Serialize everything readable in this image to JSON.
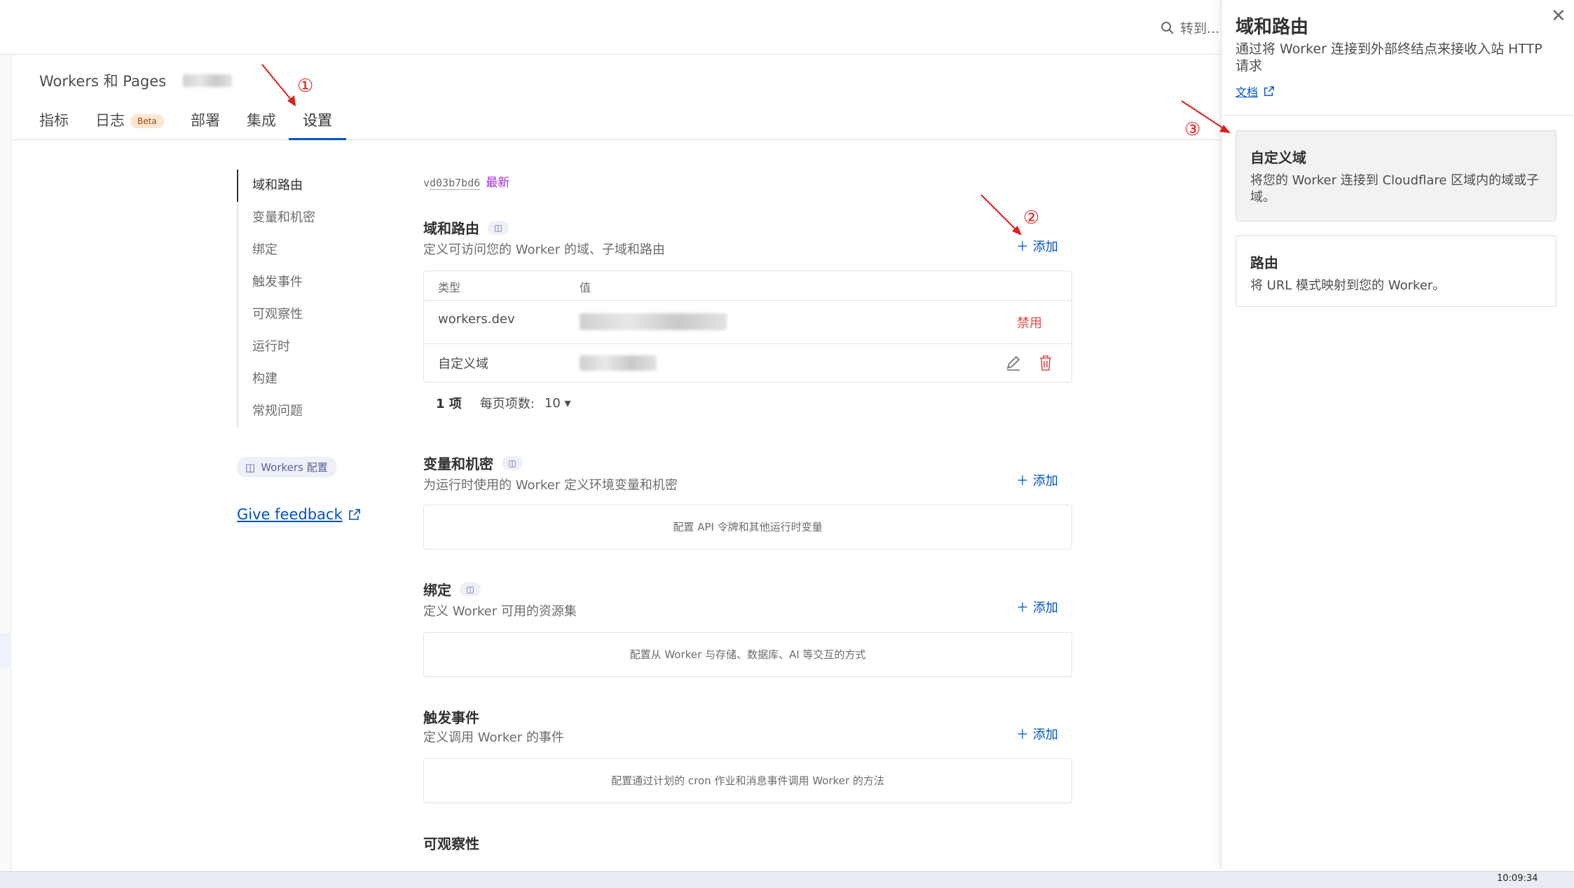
{
  "topbar": {
    "goto_label": "转到..."
  },
  "header": {
    "breadcrumb": "Workers 和 Pages",
    "tabs": [
      {
        "label": "指标"
      },
      {
        "label": "日志",
        "badge": "Beta"
      },
      {
        "label": "部署"
      },
      {
        "label": "集成"
      },
      {
        "label": "设置"
      }
    ]
  },
  "annotations": [
    "①",
    "②",
    "③"
  ],
  "sidenav": {
    "items": [
      "域和路由",
      "变量和机密",
      "绑定",
      "触发事件",
      "可观察性",
      "运行时",
      "构建",
      "常规问题"
    ],
    "config_badge": "Workers 配置",
    "feedback": "Give feedback"
  },
  "main": {
    "version_prefix": "v",
    "version_hash": "d03b7bd6",
    "version_latest": "最新",
    "add_label": "添加",
    "domains": {
      "title": "域和路由",
      "subtitle": "定义可访问您的 Worker 的域、子域和路由",
      "columns": [
        "类型",
        "值"
      ],
      "rows": [
        {
          "type": "workers.dev",
          "action": "禁用"
        },
        {
          "type": "自定义域"
        }
      ],
      "count": "1 项",
      "per_page_label": "每页项数:",
      "per_page_value": "10"
    },
    "variables": {
      "title": "变量和机密",
      "subtitle": "为运行时使用的 Worker 定义环境变量和机密",
      "empty": "配置 API 令牌和其他运行时变量"
    },
    "bindings": {
      "title": "绑定",
      "subtitle": "定义 Worker 可用的资源集",
      "empty": "配置从 Worker 与存储、数据库、AI 等交互的方式"
    },
    "triggers": {
      "title": "触发事件",
      "subtitle": "定义调用 Worker 的事件",
      "empty": "配置通过计划的 cron 作业和消息事件调用 Worker 的方法"
    },
    "observability": {
      "title": "可观察性"
    }
  },
  "panel": {
    "title": "域和路由",
    "description": "通过将 Worker 连接到外部终结点来接收入站 HTTP 请求",
    "doc_link": "文档",
    "cards": [
      {
        "title": "自定义域",
        "description": "将您的 Worker 连接到 Cloudflare 区域内的域或子域。"
      },
      {
        "title": "路由",
        "description": "将 URL 模式映射到您的 Worker。"
      }
    ]
  },
  "taskbar": {
    "clock": "10:09:34"
  },
  "colors": {
    "accent": "#0051c3",
    "danger": "#e04a4a",
    "annotation": "#e21d1d",
    "latest": "#a32ed4"
  }
}
